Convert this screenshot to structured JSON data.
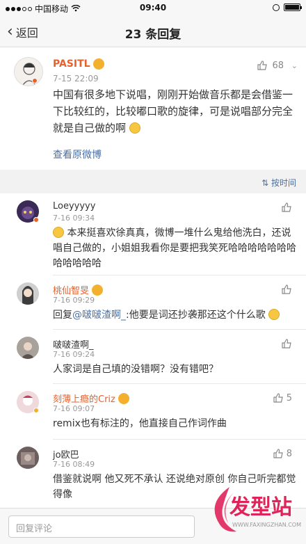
{
  "status_bar": {
    "carrier": "中国移动",
    "time": "09:40"
  },
  "nav": {
    "back_label": "返回",
    "title": "23 条回复"
  },
  "post": {
    "author": "PASITL",
    "time": "7-15 22:09",
    "likes": "68",
    "content": "中国有很多地下说唱，刚刚开始做音乐都是会借鉴一下比较红的，比较嘟口歌的旋律，可是说唱部分完全就是自己做的啊",
    "link": "查看原微博"
  },
  "sort_label": "按时间",
  "comments": [
    {
      "name": "Loeyyyyy",
      "time": "7-16 09:34",
      "likes": "",
      "text": "本来挺喜欢徐真真，微博一堆什么鬼给他洗白，还说唱自己做的，小姐姐我看你是要把我笑死哈哈哈哈哈哈哈哈哈哈哈哈"
    },
    {
      "name": "桃仙智旻",
      "time": "7-16 09:29",
      "likes": "",
      "reply_prefix": "回复",
      "mention": "@啵啵渣啊_",
      "text": ":他要是词还抄袭那还这个什么歌"
    },
    {
      "name": "啵啵渣啊_",
      "time": "7-16 09:24",
      "likes": "",
      "text": "人家词是自己填的没错啊？没有错吧？"
    },
    {
      "name": "刻薄上瘾的Criz",
      "time": "7-16 09:07",
      "likes": "5",
      "text": "remix也有标注的，他直接自己作词作曲"
    },
    {
      "name": "jo欧巴",
      "time": "7-16 08:49",
      "likes": "8",
      "text": "借鉴就说啊 他又死不承认 还说绝对原创 你自己听完都觉得像"
    }
  ],
  "comment_input": {
    "placeholder": "回复评论"
  },
  "watermark": {
    "brand": "发型站",
    "url": "WWW.FAXINGZHAN.COM"
  },
  "colors": {
    "accent_orange": "#e8602a",
    "link_blue": "#4a6fa3",
    "watermark_pink": "#e0245a"
  }
}
